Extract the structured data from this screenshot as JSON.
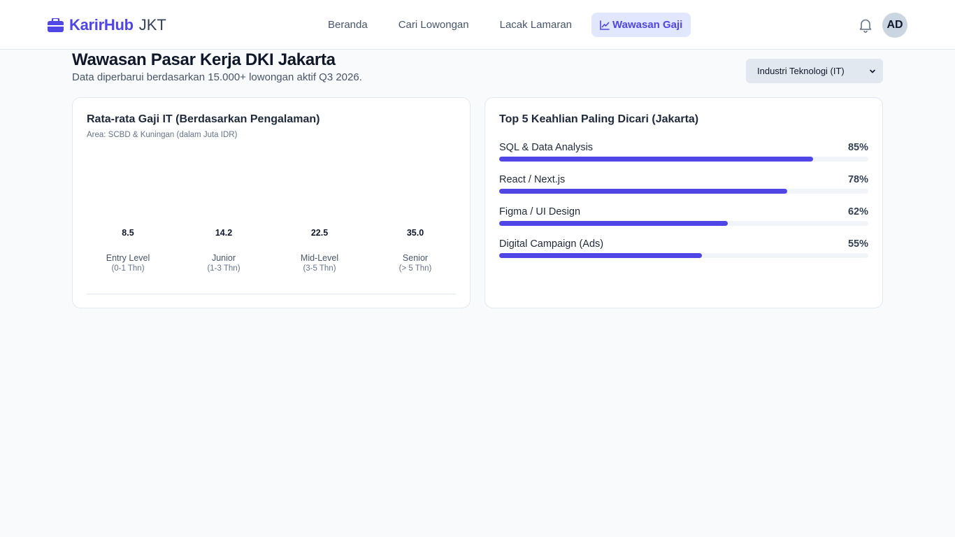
{
  "brand": {
    "name": "KarirHub",
    "city": "JKT"
  },
  "nav": {
    "items": [
      {
        "label": "Beranda",
        "active": false
      },
      {
        "label": "Cari Lowongan",
        "active": false
      },
      {
        "label": "Lacak Lamaran",
        "active": false
      },
      {
        "label": "Wawasan Gaji",
        "active": true
      }
    ]
  },
  "user": {
    "initials": "AD"
  },
  "page": {
    "title": "Wawasan Pasar Kerja DKI Jakarta",
    "subtitle": "Data diperbarui berdasarkan 15.000+ lowongan aktif Q3 2026.",
    "industry_select": "Industri Teknologi (IT)"
  },
  "salary_card": {
    "title": "Rata-rata Gaji IT (Berdasarkan Pengalaman)",
    "subtitle": "Area: SCBD & Kuningan (dalam Juta IDR)"
  },
  "skills_card": {
    "title": "Top 5 Keahlian Paling Dicari (Jakarta)"
  },
  "chart_data": [
    {
      "type": "bar",
      "title": "Rata-rata Gaji IT (Berdasarkan Pengalaman)",
      "subtitle": "Area: SCBD & Kuningan (dalam Juta IDR)",
      "categories": [
        "Entry Level",
        "Junior",
        "Mid-Level",
        "Senior"
      ],
      "category_ranges": [
        "(0-1 Thn)",
        "(1-3 Thn)",
        "(3-5 Thn)",
        "(> 5 Thn)"
      ],
      "values": [
        8.5,
        14.2,
        22.5,
        35.0
      ],
      "value_labels": [
        "8.5",
        "14.2",
        "22.5",
        "35.0"
      ]
    },
    {
      "type": "bar",
      "orientation": "horizontal",
      "title": "Top 5 Keahlian Paling Dicari (Jakarta)",
      "categories": [
        "SQL & Data Analysis",
        "React / Next.js",
        "Figma / UI Design",
        "Digital Campaign (Ads)"
      ],
      "values": [
        85,
        78,
        62,
        55
      ],
      "value_labels": [
        "85%",
        "78%",
        "62%",
        "55%"
      ],
      "color": "#4f46e5"
    }
  ]
}
